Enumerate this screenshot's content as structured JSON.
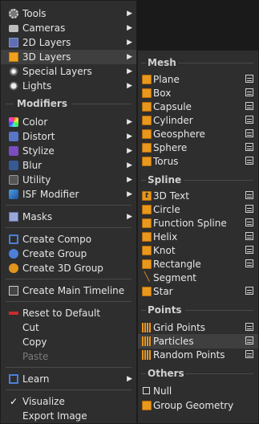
{
  "main_menu": {
    "items": [
      {
        "label": "Tools",
        "icon": "gear-icon"
      },
      {
        "label": "Cameras",
        "icon": "camera-icon"
      },
      {
        "label": "2D Layers",
        "icon": "2d-layer-icon"
      },
      {
        "label": "3D Layers",
        "icon": "3d-layer-icon"
      },
      {
        "label": "Special Layers",
        "icon": "special-layer-icon"
      },
      {
        "label": "Lights",
        "icon": "light-icon"
      },
      {
        "label": "Modifiers"
      },
      {
        "label": "Color",
        "icon": "color-icon"
      },
      {
        "label": "Distort",
        "icon": "distort-icon"
      },
      {
        "label": "Stylize",
        "icon": "stylize-icon"
      },
      {
        "label": "Blur",
        "icon": "blur-icon"
      },
      {
        "label": "Utility",
        "icon": "utility-icon"
      },
      {
        "label": "ISF Modifier",
        "icon": "isf-icon"
      },
      {
        "label": "Masks",
        "icon": "mask-icon"
      },
      {
        "label": "Create Compo",
        "icon": "compo-icon"
      },
      {
        "label": "Create Group",
        "icon": "group-icon"
      },
      {
        "label": "Create 3D Group",
        "icon": "3d-group-icon"
      },
      {
        "label": "Create Main Timeline",
        "icon": "timeline-icon"
      },
      {
        "label": "Reset to Default",
        "icon": "reset-icon"
      },
      {
        "label": "Cut"
      },
      {
        "label": "Copy"
      },
      {
        "label": "Paste"
      },
      {
        "label": "Learn",
        "icon": "learn-icon"
      },
      {
        "label": "Visualize",
        "icon": "checkmark-icon"
      },
      {
        "label": "Export Image"
      }
    ]
  },
  "sub_menu": {
    "sections": [
      {
        "title": "Mesh",
        "items": [
          "Plane",
          "Box",
          "Capsule",
          "Cylinder",
          "Geosphere",
          "Sphere",
          "Torus"
        ]
      },
      {
        "title": "Spline",
        "items": [
          "3D Text",
          "Circle",
          "Function Spline",
          "Helix",
          "Knot",
          "Rectangle",
          "Segment",
          "Star"
        ]
      },
      {
        "title": "Points",
        "items": [
          "Grid Points",
          "Particles",
          "Random Points"
        ]
      },
      {
        "title": "Others",
        "items": [
          "Null",
          "Group Geometry"
        ]
      }
    ]
  },
  "colors": {
    "menu_bg": "#2e2e2e",
    "highlight": "#3f3f3f",
    "accent_orange": "#e8981c",
    "accent_blue": "#4c7fd8"
  }
}
